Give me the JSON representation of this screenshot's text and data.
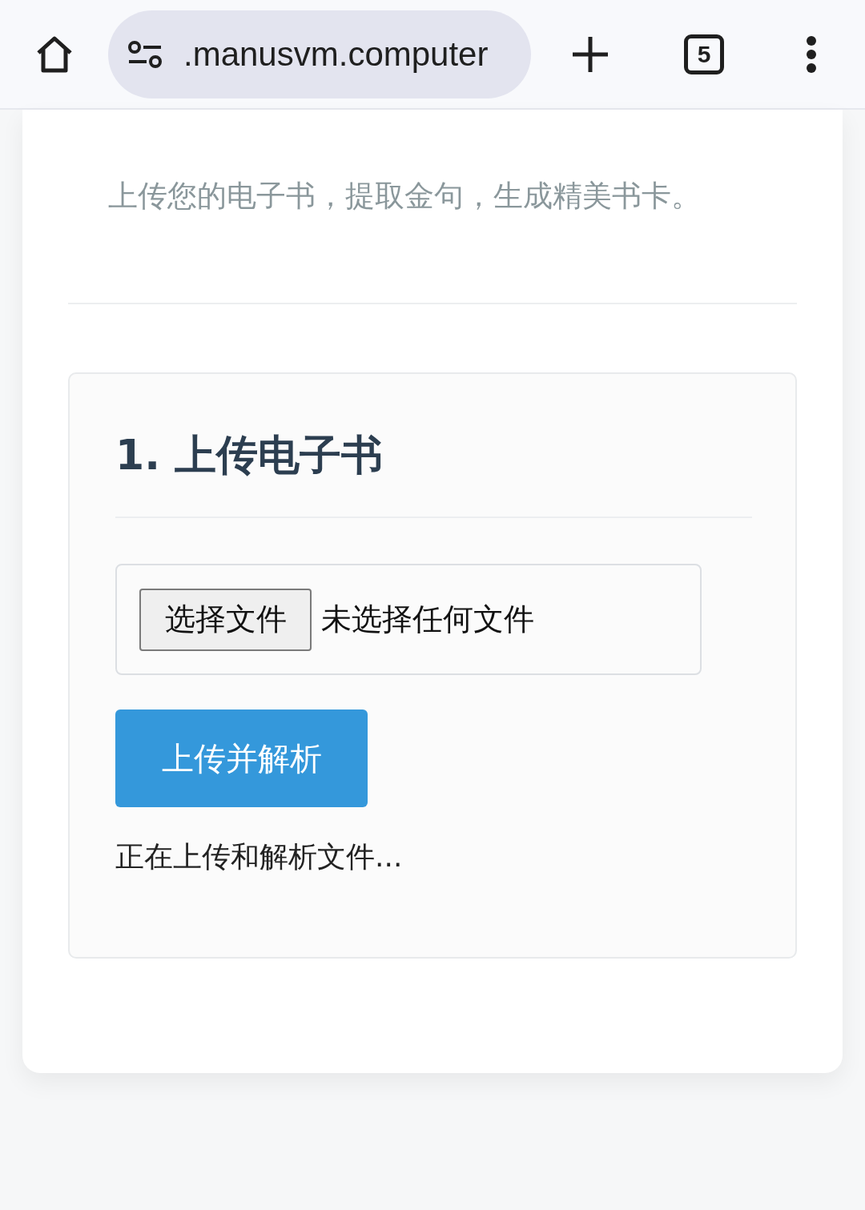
{
  "browser": {
    "url": ".manusvm.computer",
    "tab_count": "5"
  },
  "subtitle": "上传您的电子书，提取金句，生成精美书卡。",
  "section": {
    "title": "1. 上传电子书",
    "file_input": {
      "button": "选择文件",
      "status": "未选择任何文件"
    },
    "upload_button": "上传并解析",
    "status": "正在上传和解析文件..."
  }
}
